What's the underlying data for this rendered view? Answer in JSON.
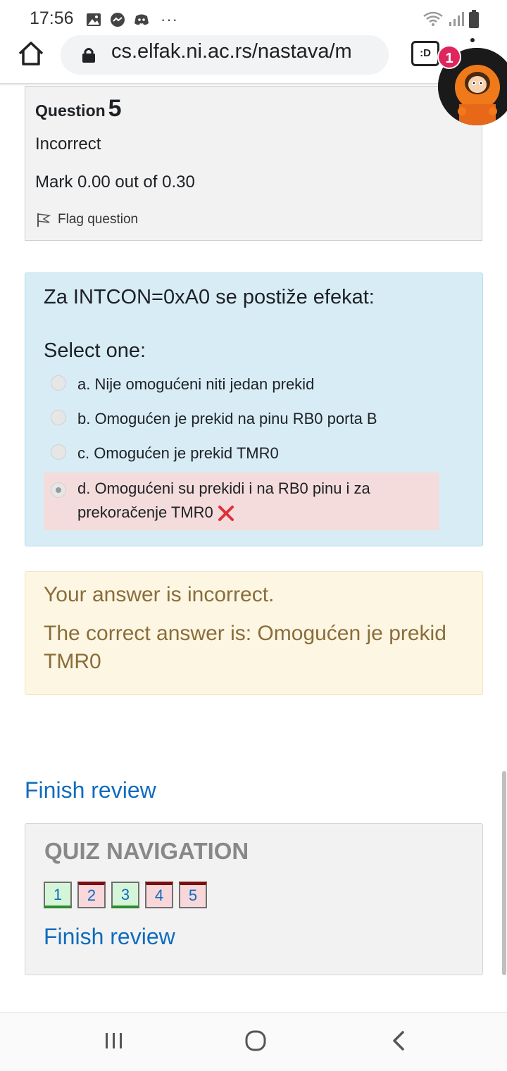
{
  "status_bar": {
    "time": "17:56",
    "more": "···"
  },
  "browser": {
    "url": "cs.elfak.ni.ac.rs/nastava/m",
    "tabs_label": ":D",
    "notification_count": "1"
  },
  "question": {
    "title_prefix": "Question",
    "number": "5",
    "state": "Incorrect",
    "mark": "Mark 0.00 out of 0.30",
    "flag_label": "Flag question"
  },
  "formulation": {
    "text": "Za INTCON=0xA0 se postiže efekat:",
    "prompt": "Select one:",
    "answers": [
      {
        "label": "a. Nije omogućeni niti jedan prekid"
      },
      {
        "label": "b. Omogućen je prekid na pinu RB0 porta B"
      },
      {
        "label": "c. Omogućen je prekid TMR0"
      },
      {
        "label": "d. Omogućeni su prekidi i na RB0 pinu i za prekoračenje TMR0"
      }
    ]
  },
  "feedback": {
    "line1": "Your answer is incorrect.",
    "line2": "The correct answer is: Omogućen je prekid TMR0"
  },
  "finish_review": "Finish review",
  "quiz_navigation": {
    "title": "QUIZ NAVIGATION",
    "buttons": [
      "1",
      "2",
      "3",
      "4",
      "5"
    ],
    "finish_review": "Finish review"
  },
  "colors": {
    "link": "#0f6cbf",
    "feedback_text": "#8a6d3b",
    "incorrect_bg": "#f4dcdc",
    "formulation_bg": "#d8ecf6"
  }
}
